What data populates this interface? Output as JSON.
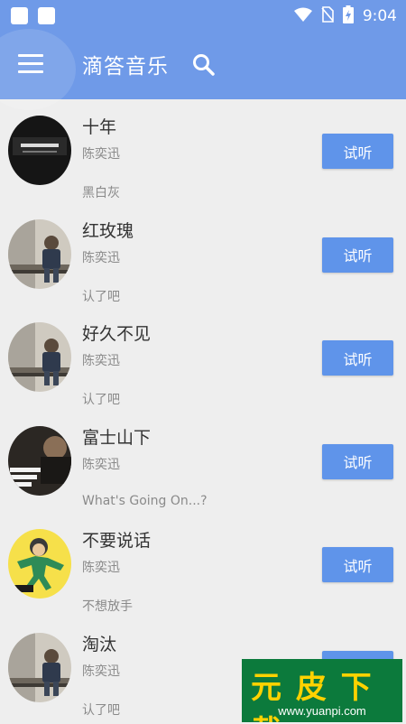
{
  "status": {
    "time": "9:04"
  },
  "app": {
    "title": "滴答音乐"
  },
  "songs": [
    {
      "title": "十年",
      "artist": "陈奕迅",
      "album": "黑白灰",
      "action": "试听",
      "cover": "dark"
    },
    {
      "title": "红玫瑰",
      "artist": "陈奕迅",
      "album": "认了吧",
      "action": "试听",
      "cover": "portrait"
    },
    {
      "title": "好久不见",
      "artist": "陈奕迅",
      "album": "认了吧",
      "action": "试听",
      "cover": "portrait"
    },
    {
      "title": "富士山下",
      "artist": "陈奕迅",
      "album": "What's Going On...?",
      "action": "试听",
      "cover": "whats"
    },
    {
      "title": "不要说话",
      "artist": "陈奕迅",
      "album": "不想放手",
      "action": "试听",
      "cover": "yellow"
    },
    {
      "title": "淘汰",
      "artist": "陈奕迅",
      "album": "认了吧",
      "action": "试听",
      "cover": "portrait"
    }
  ],
  "watermark": {
    "brand": "元 皮 下 载",
    "url": "www.yuanpi.com"
  },
  "colors": {
    "primary": "#6f9ae8",
    "button": "#5f94ea",
    "background": "#eeeeee"
  }
}
